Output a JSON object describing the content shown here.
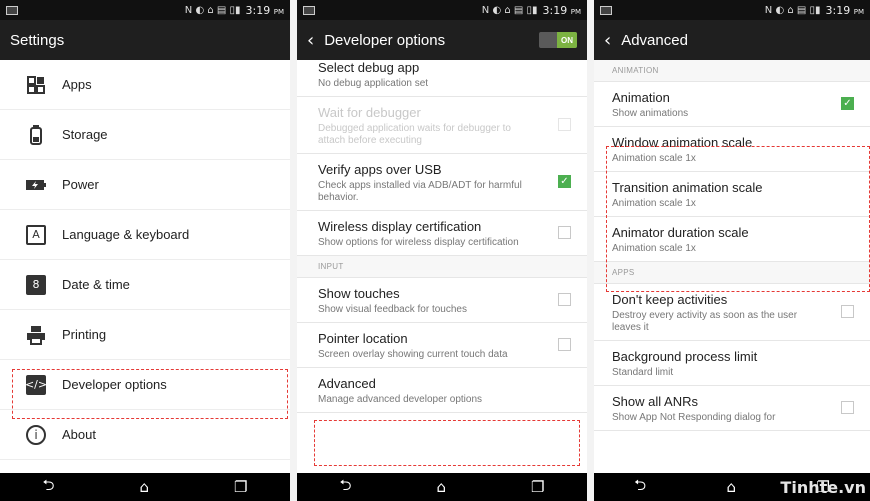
{
  "status": {
    "time": "3:19",
    "ampm": "PM",
    "sys_icons": "N ◐ ⌂ ▤ ▯▮"
  },
  "settings": {
    "title": "Settings",
    "items": [
      {
        "label": "Apps",
        "icon": "apps-grid-icon"
      },
      {
        "label": "Storage",
        "icon": "storage-icon"
      },
      {
        "label": "Power",
        "icon": "battery-icon"
      },
      {
        "label": "Language & keyboard",
        "icon": "keyboard-icon"
      },
      {
        "label": "Date & time",
        "icon": "calendar-icon"
      },
      {
        "label": "Printing",
        "icon": "printer-icon"
      },
      {
        "label": "Developer options",
        "icon": "code-icon"
      },
      {
        "label": "About",
        "icon": "info-icon"
      }
    ],
    "calendar_day": "8"
  },
  "developer": {
    "title": "Developer options",
    "toggle": "ON",
    "rows": [
      {
        "title": "Select debug app",
        "summary": "No debug application set"
      },
      {
        "title": "Wait for debugger",
        "summary": "Debugged application waits for debugger to attach before executing",
        "checked": false,
        "disabled": true
      },
      {
        "title": "Verify apps over USB",
        "summary": "Check apps installed via ADB/ADT for harmful behavior.",
        "checked": true
      },
      {
        "title": "Wireless display certification",
        "summary": "Show options for wireless display certification",
        "checked": false
      }
    ],
    "input_header": "INPUT",
    "input_rows": [
      {
        "title": "Show touches",
        "summary": "Show visual feedback for touches",
        "checked": false
      },
      {
        "title": "Pointer location",
        "summary": "Screen overlay showing current touch data",
        "checked": false
      },
      {
        "title": "Advanced",
        "summary": "Manage advanced developer options"
      }
    ]
  },
  "advanced": {
    "title": "Advanced",
    "animation_header": "ANIMATION",
    "animation_rows": [
      {
        "title": "Animation",
        "summary": "Show animations",
        "checked": true
      },
      {
        "title": "Window animation scale",
        "summary": "Animation scale 1x"
      },
      {
        "title": "Transition animation scale",
        "summary": "Animation scale 1x"
      },
      {
        "title": "Animator duration scale",
        "summary": "Animation scale 1x"
      }
    ],
    "apps_header": "APPS",
    "apps_rows": [
      {
        "title": "Don't keep activities",
        "summary": "Destroy every activity as soon as the user leaves it",
        "checked": false
      },
      {
        "title": "Background process limit",
        "summary": "Standard limit"
      },
      {
        "title": "Show all ANRs",
        "summary": "Show App Not Responding dialog for",
        "checked": false
      }
    ]
  },
  "nav": {
    "back": "⮌",
    "home": "⌂",
    "recents": "❐"
  },
  "watermark": "Tinhte.vn",
  "colors": {
    "highlight": "#e53935",
    "check": "#4caf50",
    "toggle_on": "#7cb342"
  }
}
